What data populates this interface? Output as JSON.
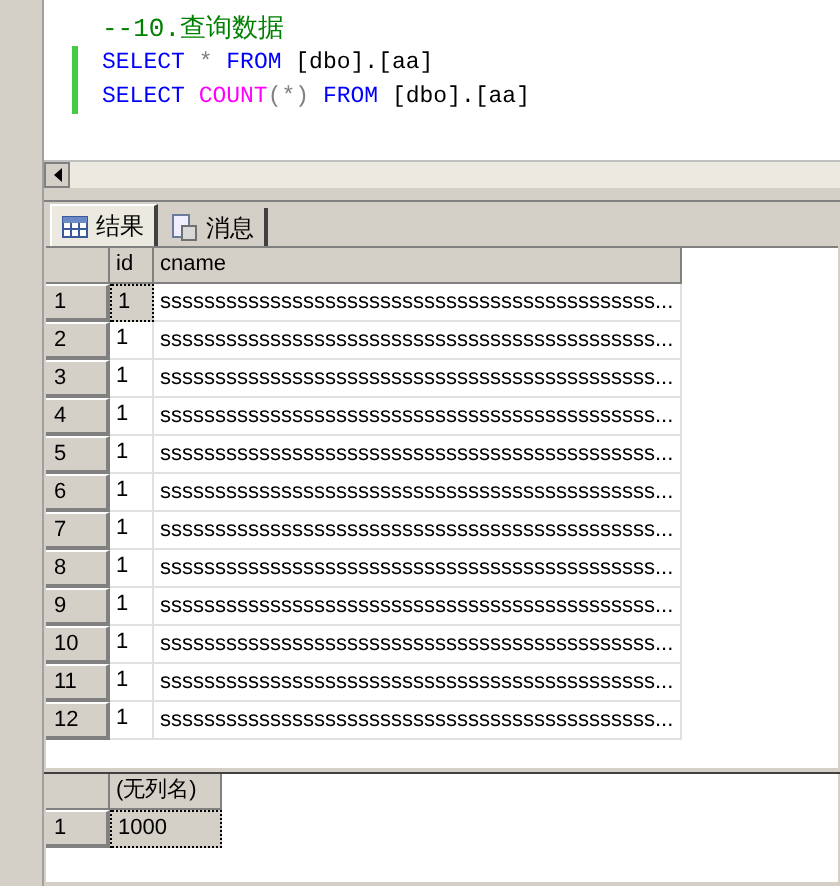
{
  "editor": {
    "lines": [
      {
        "changed": false,
        "tokens": [
          {
            "kind": "comment",
            "text": "--10.查询数据"
          }
        ]
      },
      {
        "changed": true,
        "tokens": [
          {
            "kind": "keyword",
            "text": "SELECT"
          },
          {
            "kind": "operator",
            "text": " * "
          },
          {
            "kind": "keyword",
            "text": "FROM"
          },
          {
            "kind": "plain",
            "text": " [dbo].[aa]"
          }
        ]
      },
      {
        "changed": true,
        "tokens": [
          {
            "kind": "keyword",
            "text": "SELECT"
          },
          {
            "kind": "function",
            "text": " COUNT"
          },
          {
            "kind": "operator",
            "text": "(*) "
          },
          {
            "kind": "keyword",
            "text": "FROM"
          },
          {
            "kind": "plain",
            "text": " [dbo].[aa]"
          }
        ]
      }
    ]
  },
  "tabs": [
    {
      "label": "结果",
      "kind": "grid",
      "selected": true
    },
    {
      "label": "消息",
      "kind": "messages",
      "selected": false
    }
  ],
  "grids": [
    {
      "columns": [
        "id",
        "cname"
      ],
      "rows": [
        {
          "number": "1",
          "selected": true,
          "cells": [
            "1",
            "sssssssssssssssssssssssssssssssssssssssssssss..."
          ]
        },
        {
          "number": "2",
          "selected": false,
          "cells": [
            "1",
            "sssssssssssssssssssssssssssssssssssssssssssss..."
          ]
        },
        {
          "number": "3",
          "selected": false,
          "cells": [
            "1",
            "sssssssssssssssssssssssssssssssssssssssssssss..."
          ]
        },
        {
          "number": "4",
          "selected": false,
          "cells": [
            "1",
            "sssssssssssssssssssssssssssssssssssssssssssss..."
          ]
        },
        {
          "number": "5",
          "selected": false,
          "cells": [
            "1",
            "sssssssssssssssssssssssssssssssssssssssssssss..."
          ]
        },
        {
          "number": "6",
          "selected": false,
          "cells": [
            "1",
            "sssssssssssssssssssssssssssssssssssssssssssss..."
          ]
        },
        {
          "number": "7",
          "selected": false,
          "cells": [
            "1",
            "sssssssssssssssssssssssssssssssssssssssssssss..."
          ]
        },
        {
          "number": "8",
          "selected": false,
          "cells": [
            "1",
            "sssssssssssssssssssssssssssssssssssssssssssss..."
          ]
        },
        {
          "number": "9",
          "selected": false,
          "cells": [
            "1",
            "sssssssssssssssssssssssssssssssssssssssssssss..."
          ]
        },
        {
          "number": "10",
          "selected": false,
          "cells": [
            "1",
            "sssssssssssssssssssssssssssssssssssssssssssss..."
          ]
        },
        {
          "number": "11",
          "selected": false,
          "cells": [
            "1",
            "sssssssssssssssssssssssssssssssssssssssssssss..."
          ]
        },
        {
          "number": "12",
          "selected": false,
          "cells": [
            "1",
            "sssssssssssssssssssssssssssssssssssssssssssss..."
          ]
        }
      ]
    },
    {
      "columns": [
        "(无列名)"
      ],
      "rows": [
        {
          "number": "1",
          "selected": true,
          "cells": [
            "1000"
          ]
        }
      ]
    }
  ]
}
